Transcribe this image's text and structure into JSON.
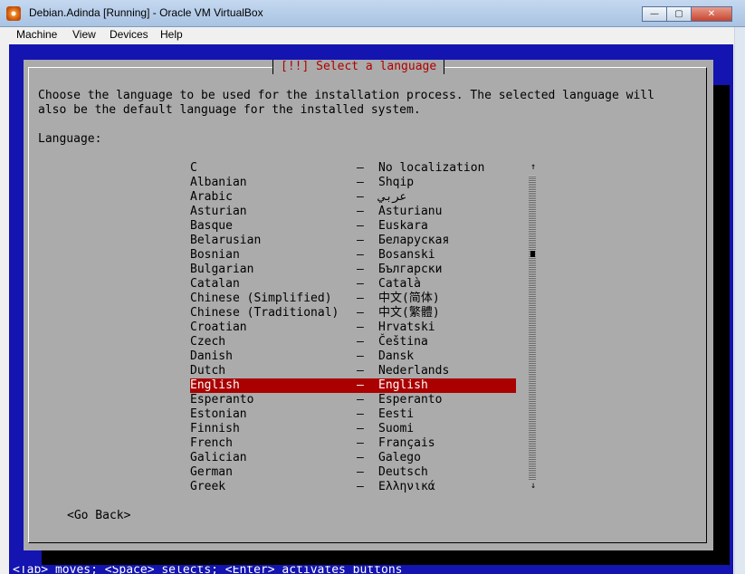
{
  "window": {
    "title": "Debian.Adinda [Running] - Oracle VM VirtualBox",
    "minimize": "—",
    "maximize": "▢",
    "close": "✕"
  },
  "menu": {
    "items": [
      "Machine",
      "View",
      "Devices",
      "Help"
    ]
  },
  "dialog": {
    "title": "[!!] Select a language",
    "description_line1": "Choose the language to be used for the installation process. The selected language will",
    "description_line2": "also be the default language for the installed system.",
    "list_label": "Language:",
    "separator": "–",
    "languages": [
      {
        "name": "C",
        "native": "No localization"
      },
      {
        "name": "Albanian",
        "native": "Shqip"
      },
      {
        "name": "Arabic",
        "native": "عربي"
      },
      {
        "name": "Asturian",
        "native": "Asturianu"
      },
      {
        "name": "Basque",
        "native": "Euskara"
      },
      {
        "name": "Belarusian",
        "native": "Беларуская"
      },
      {
        "name": "Bosnian",
        "native": "Bosanski"
      },
      {
        "name": "Bulgarian",
        "native": "Български"
      },
      {
        "name": "Catalan",
        "native": "Català"
      },
      {
        "name": "Chinese (Simplified)",
        "native": "中文(简体)"
      },
      {
        "name": "Chinese (Traditional)",
        "native": "中文(繁體)"
      },
      {
        "name": "Croatian",
        "native": "Hrvatski"
      },
      {
        "name": "Czech",
        "native": "Čeština"
      },
      {
        "name": "Danish",
        "native": "Dansk"
      },
      {
        "name": "Dutch",
        "native": "Nederlands"
      },
      {
        "name": "English",
        "native": "English"
      },
      {
        "name": "Esperanto",
        "native": "Esperanto"
      },
      {
        "name": "Estonian",
        "native": "Eesti"
      },
      {
        "name": "Finnish",
        "native": "Suomi"
      },
      {
        "name": "French",
        "native": "Français"
      },
      {
        "name": "Galician",
        "native": "Galego"
      },
      {
        "name": "German",
        "native": "Deutsch"
      },
      {
        "name": "Greek",
        "native": "Ελληνικά"
      }
    ],
    "selected": "English",
    "scroll_up": "↑",
    "scroll_down": "↓",
    "go_back": "<Go Back>"
  },
  "status_bar": "<Tab> moves; <Space> selects; <Enter> activates buttons",
  "colors": {
    "screen_blue": "#1414b0",
    "dialog_gray": "#ababab",
    "highlight_red": "#aa0000",
    "title_red": "#b00000"
  }
}
